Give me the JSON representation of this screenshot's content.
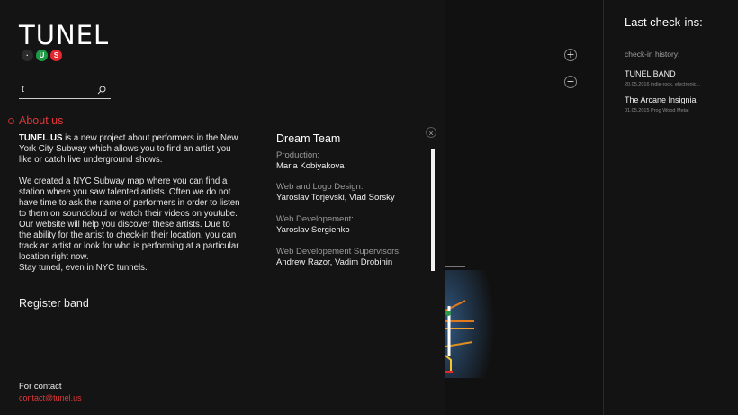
{
  "brand": {
    "logo": "TUNEL",
    "lines": [
      "·",
      "U",
      "S"
    ]
  },
  "search": {
    "value": "t"
  },
  "about": {
    "title": "About us",
    "brand_name": "TUNEL.US",
    "para1": " is a new project about performers in the New York City Subway which allows you to find an artist you like or catch live underground shows.",
    "para2": "We created a NYC Subway map where you can find a station where you saw talented artists. Often we do not have time to ask the name of performers in order to listen to them on soundcloud or watch their videos on youtube. Our website will help you discover these artists. Due to the ability for the artist to check-in their location, you can track an artist or look for who is performing at a particular location right now.",
    "para3": "Stay tuned, even in NYC tunnels."
  },
  "register": {
    "label": "Register band"
  },
  "contact": {
    "label": "For contact",
    "email": "contact@tunel.us"
  },
  "team": {
    "title": "Dream Team",
    "close": "×",
    "members": [
      {
        "role": "Production:",
        "names": "Maria Kobiyakova"
      },
      {
        "role": "Web and Logo Design:",
        "names": "Yaroslav Torjevski, Vlad Sorsky"
      },
      {
        "role": "Web Developement:",
        "names": "Yaroslav Sergienko"
      },
      {
        "role": "Web Developement Supervisors:",
        "names": "Andrew Razor, Vadim Drobinin"
      }
    ]
  },
  "map": {
    "zoom_in": "+",
    "zoom_out": "−"
  },
  "checkins": {
    "title": "Last check-ins:",
    "history_label": "check-in history:",
    "items": [
      {
        "name": "TUNEL BAND",
        "meta": "20.05.2016  indie-rock, electronic..."
      },
      {
        "name": "The Arcane Insignia",
        "meta": "01.05.2015  Prog Wood Metal"
      }
    ]
  },
  "colors": {
    "accent_red": "#e2383a",
    "line_green": "#1f9a44",
    "line_red": "#e2272e",
    "background": "#141414"
  }
}
